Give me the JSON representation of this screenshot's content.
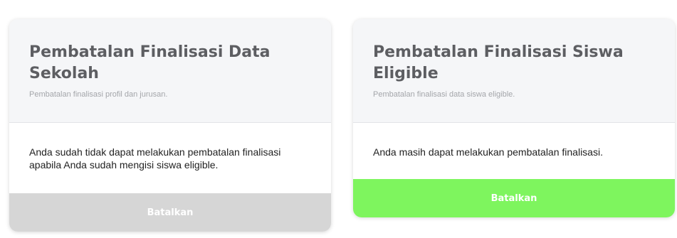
{
  "cards": [
    {
      "title": "Pembatalan Finalisasi Data Sekolah",
      "subtitle": "Pembatalan finalisasi profil dan jurusan.",
      "message": "Anda sudah tidak dapat melakukan pembatalan finalisasi apabila Anda sudah mengisi siswa eligible.",
      "button_label": "Batalkan",
      "button_state": "disabled",
      "button_color": "#d6d6d6"
    },
    {
      "title": "Pembatalan Finalisasi Siswa Eligible",
      "subtitle": "Pembatalan finalisasi data siswa eligible.",
      "message": "Anda masih dapat melakukan pembatalan finalisasi.",
      "button_label": "Batalkan",
      "button_state": "enabled",
      "button_color": "#7ef55e"
    }
  ]
}
